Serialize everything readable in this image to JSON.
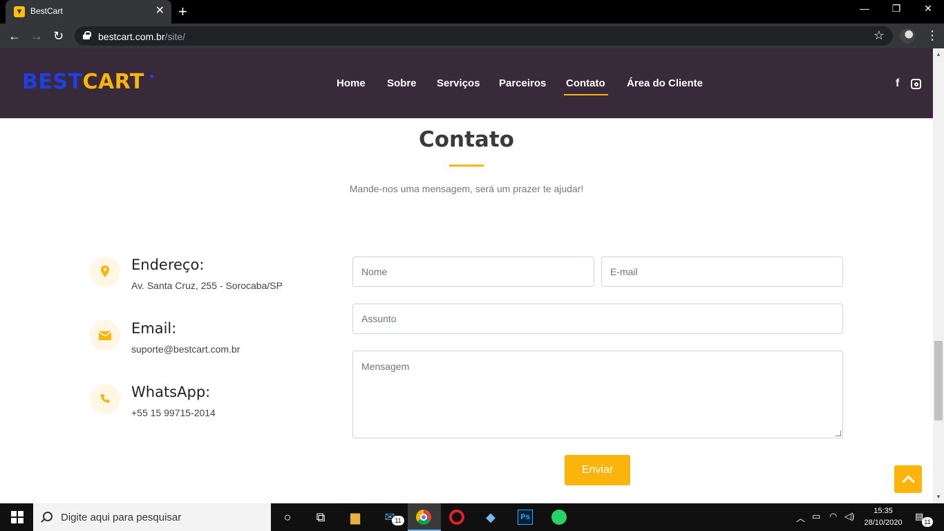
{
  "browser": {
    "tab_title": "BestCart",
    "tab_close": "✕",
    "new_tab": "+",
    "url_host": "bestcart.com.br",
    "url_path": "/site/",
    "win_min": "—",
    "win_max": "❐",
    "win_close": "✕"
  },
  "header": {
    "logo_part1": "BEST",
    "logo_part2": "CART",
    "nav": [
      "Home",
      "Sobre",
      "Serviços",
      "Parceiros",
      "Contato",
      "Área do Cliente"
    ],
    "active_nav": "Contato",
    "social_facebook": "f"
  },
  "contact": {
    "title": "Contato",
    "subtitle": "Mande-nos uma mensagem, será um prazer te ajudar!",
    "info": [
      {
        "title": "Endereço:",
        "text": "Av. Santa Cruz, 255 - Sorocaba/SP",
        "icon": "map-pin-icon"
      },
      {
        "title": "Email:",
        "text": "suporte@bestcart.com.br",
        "icon": "envelope-icon"
      },
      {
        "title": "WhatsApp:",
        "text": "+55 15 99715-2014",
        "icon": "phone-icon"
      }
    ],
    "form": {
      "name_placeholder": "Nome",
      "email_placeholder": "E-mail",
      "subject_placeholder": "Assunto",
      "message_placeholder": "Mensagem",
      "submit_label": "Enviar"
    }
  },
  "taskbar": {
    "search_placeholder": "Digite aqui para pesquisar",
    "time": "15:35",
    "date": "28/10/2020",
    "mail_badge": "11",
    "notif_badge": "11"
  },
  "colors": {
    "accent": "#fbb40b",
    "header_bg": "#382a3b",
    "logo_blue": "#1f3fe0"
  }
}
